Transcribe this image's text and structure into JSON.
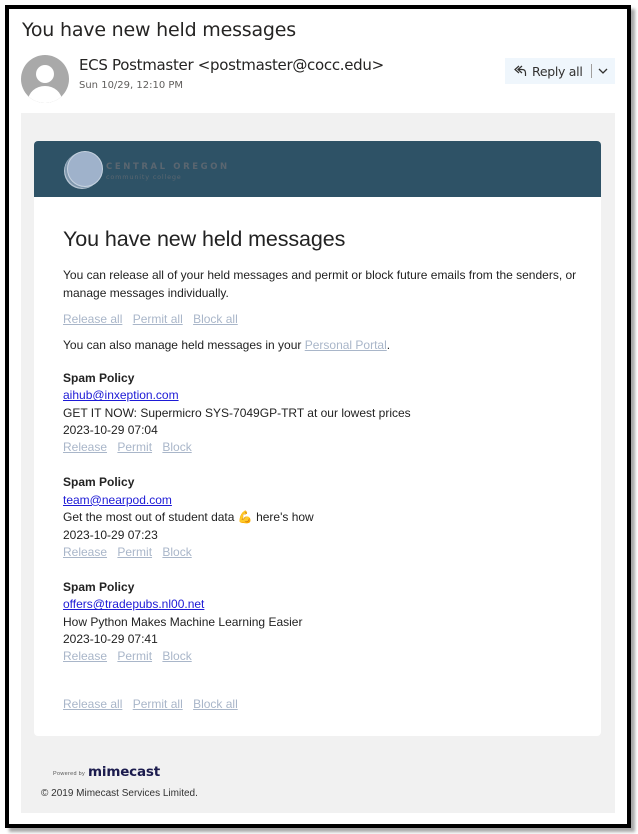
{
  "email": {
    "subject": "You have new held messages",
    "sender": "ECS Postmaster <postmaster@cocc.edu>",
    "date": "Sun 10/29, 12:10 PM",
    "reply_all_label": "Reply all"
  },
  "banner": {
    "logo_line1": "CENTRAL OREGON",
    "logo_line2": "community college",
    "color": "#2e5266"
  },
  "body": {
    "heading": "You have new held messages",
    "intro": "You can release all of your held messages and permit or block future emails from the senders, or manage messages individually.",
    "bulk_actions": {
      "release_all": "Release all",
      "permit_all": "Permit all",
      "block_all": "Block all"
    },
    "portal_prefix": "You can also manage held messages in your ",
    "portal_link": "Personal Portal",
    "portal_suffix": ".",
    "messages": [
      {
        "policy": "Spam Policy",
        "from": "aihub@inxeption.com",
        "subject": "GET IT NOW: Supermicro SYS-7049GP-TRT at our lowest prices",
        "emoji": "",
        "subject_suffix": "",
        "datetime": "2023-10-29 07:04",
        "actions": {
          "release": "Release",
          "permit": "Permit",
          "block": "Block"
        }
      },
      {
        "policy": "Spam Policy",
        "from": "team@nearpod.com",
        "subject": "Get the most out of student data ",
        "emoji": "💪",
        "subject_suffix": " here's how",
        "datetime": "2023-10-29 07:23",
        "actions": {
          "release": "Release",
          "permit": "Permit",
          "block": "Block"
        }
      },
      {
        "policy": "Spam Policy",
        "from": "offers@tradepubs.nl00.net",
        "subject": "How Python Makes Machine Learning Easier",
        "emoji": "",
        "subject_suffix": "",
        "datetime": "2023-10-29 07:41",
        "actions": {
          "release": "Release",
          "permit": "Permit",
          "block": "Block"
        }
      }
    ]
  },
  "footer": {
    "powered_by": "Powered by",
    "brand": "mimecast",
    "copyright": "© 2019 Mimecast Services Limited."
  }
}
